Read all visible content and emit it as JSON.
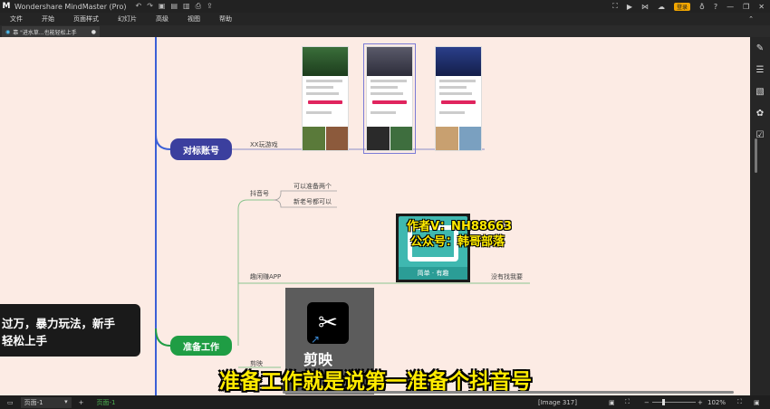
{
  "app": {
    "title": "Wondershare MindMaster (Pro)",
    "login_label": "登录"
  },
  "menu": [
    "文件",
    "开始",
    "页面样式",
    "幻灯片",
    "高级",
    "视图",
    "帮助"
  ],
  "tab": {
    "label": "靠 \"进水草...也能轻松上手",
    "dirty_mark": "●"
  },
  "mindmap": {
    "node_target": "对标账号",
    "node_prepare": "准备工作",
    "root_text_line1": "过万，暴力玩法，新手",
    "root_text_line2": "轻松上手",
    "xx_label": "XX玩游戏",
    "douyin_label": "抖音号",
    "two_accounts": "可以准备两个",
    "new_old_ok": "新老号都可以",
    "xianyu_label": "趣闲赚APP",
    "no_find_me": "没有找我要",
    "jianying_label": "剪映"
  },
  "watermark": {
    "line1": "作者V：NH88663",
    "line2": "公众号：韩哥部落",
    "app_text": "简单 · 有趣"
  },
  "capcut": {
    "name": "剪映"
  },
  "subtitle": "准备工作就是说第一准备个抖音号",
  "status": {
    "page_selector": "页面-1",
    "page_tab": "页面-1",
    "image_info": "[Image 317]",
    "zoom": "102%"
  },
  "colors": {
    "canvas_bg": "#fcebe4",
    "node_target": "#3b3f9e",
    "node_prepare": "#1f9d44",
    "branch_blue": "#3b5fd6",
    "branch_green": "#4caf50",
    "subtitle": "#ffeb00"
  }
}
